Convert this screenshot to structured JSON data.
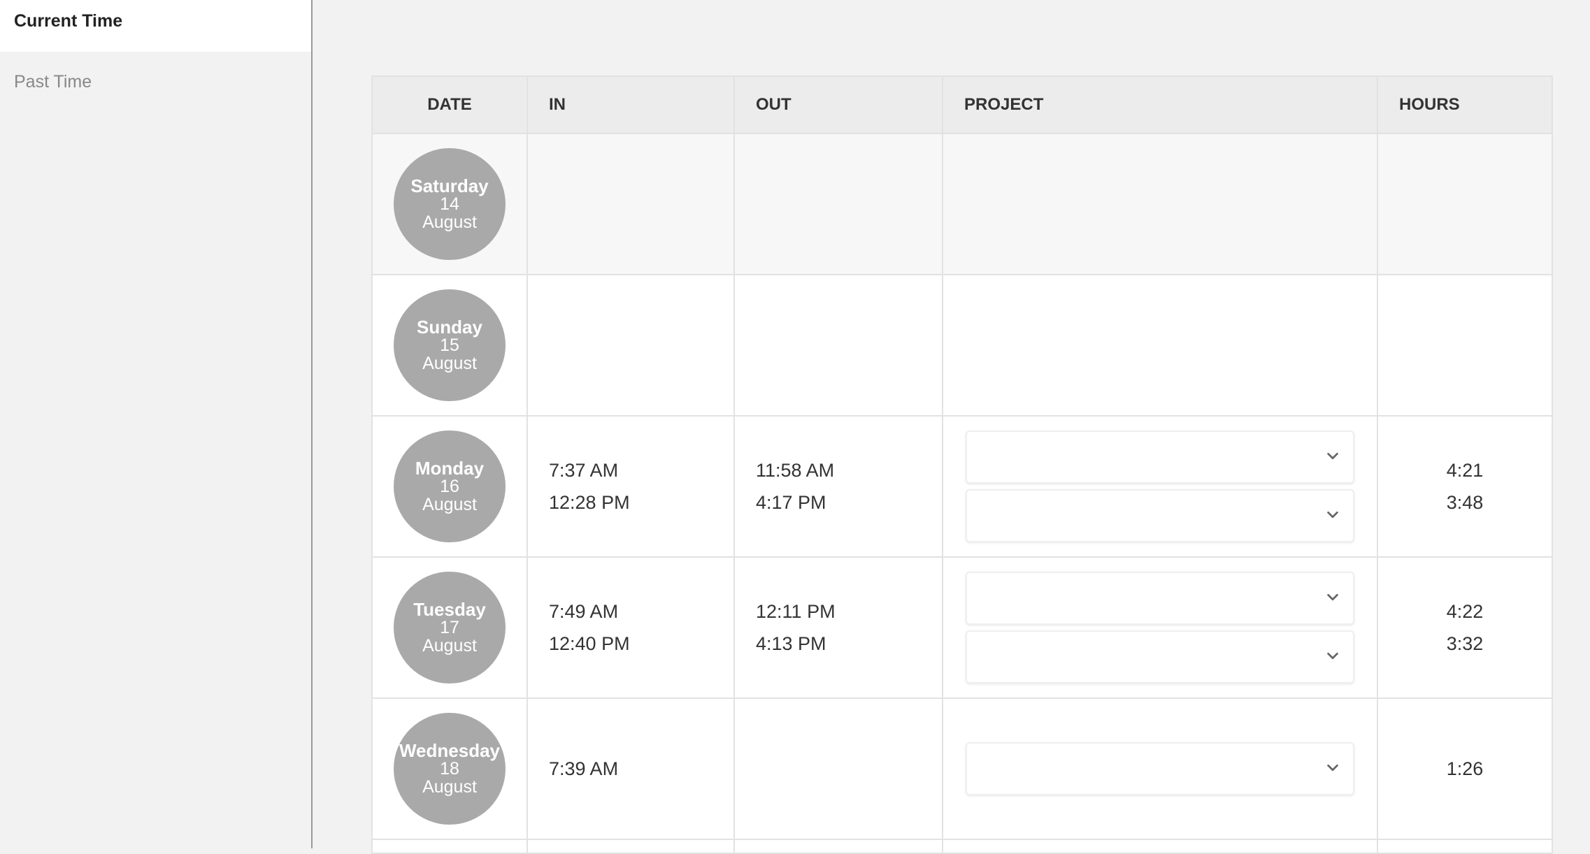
{
  "sidebar": {
    "items": [
      {
        "label": "Current Time",
        "active": true
      },
      {
        "label": "Past Time",
        "active": false
      }
    ]
  },
  "table": {
    "headers": {
      "date": "DATE",
      "in": "IN",
      "out": "OUT",
      "project": "PROJECT",
      "hours": "HOURS"
    },
    "rows": [
      {
        "day": "Saturday",
        "num": "14",
        "month": "August",
        "in": [],
        "out": [],
        "hours": []
      },
      {
        "day": "Sunday",
        "num": "15",
        "month": "August",
        "in": [],
        "out": [],
        "hours": []
      },
      {
        "day": "Monday",
        "num": "16",
        "month": "August",
        "in": [
          "7:37 AM",
          "12:28 PM"
        ],
        "out": [
          "11:58 AM",
          "4:17 PM"
        ],
        "hours": [
          "4:21",
          "3:48"
        ]
      },
      {
        "day": "Tuesday",
        "num": "17",
        "month": "August",
        "in": [
          "7:49 AM",
          "12:40 PM"
        ],
        "out": [
          "12:11 PM",
          "4:13 PM"
        ],
        "hours": [
          "4:22",
          "3:32"
        ]
      },
      {
        "day": "Wednesday",
        "num": "18",
        "month": "August",
        "in": [
          "7:39 AM"
        ],
        "out": [],
        "hours": [
          "1:26"
        ]
      }
    ]
  },
  "colors": {
    "date_circle": "#a9a9a9",
    "header_bg": "#ececec",
    "sidebar_bg": "#f2f2f2",
    "sidebar_active_bg": "#ffffff"
  },
  "icons": {
    "select_arrow": "chevron-down-icon"
  }
}
